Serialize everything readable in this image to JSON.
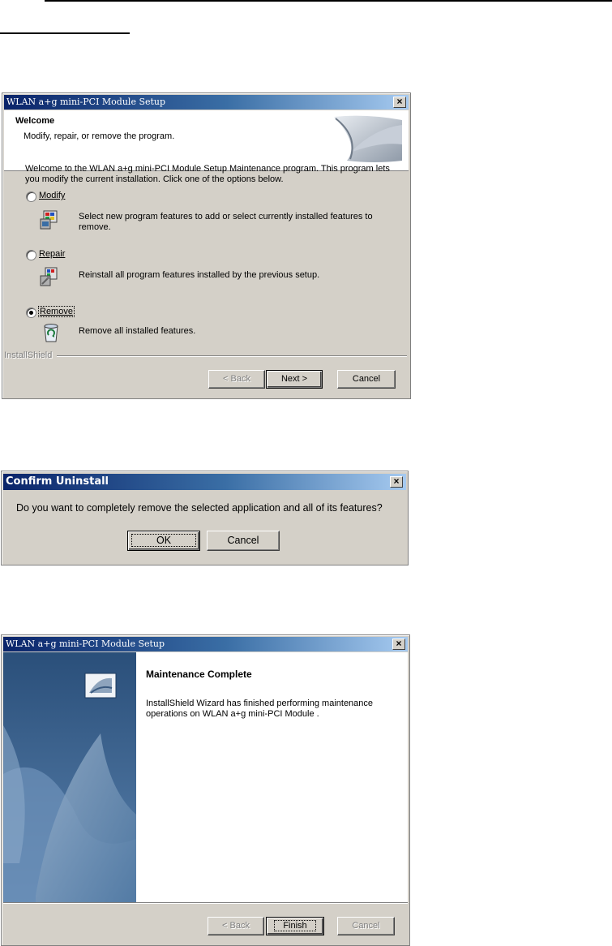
{
  "dialog1": {
    "title": "WLAN a+g mini-PCI Module Setup",
    "header_title": "Welcome",
    "header_subtitle": "Modify, repair, or remove the program.",
    "intro_line1": "Welcome to the WLAN a+g mini-PCI Module Setup Maintenance program. This program lets",
    "intro_line2": "you modify the current installation. Click one of the options below.",
    "options": [
      {
        "label": "Modify",
        "desc_line1": "Select new program features to add or select currently installed features to",
        "desc_line2": "remove.",
        "selected": false
      },
      {
        "label": "Repair",
        "desc_line1": "Reinstall all program features installed by the previous setup.",
        "selected": false
      },
      {
        "label": "Remove",
        "desc_line1": "Remove all installed features.",
        "selected": true
      }
    ],
    "brand": "InstallShield",
    "buttons": {
      "back": "< Back",
      "next": "Next >",
      "cancel": "Cancel"
    }
  },
  "dialog2": {
    "title": "Confirm Uninstall",
    "message": "Do you want to completely remove the selected application and all of its features?",
    "buttons": {
      "ok": "OK",
      "cancel": "Cancel"
    }
  },
  "dialog3": {
    "title": "WLAN a+g mini-PCI Module Setup",
    "heading": "Maintenance Complete",
    "body_line1": "InstallShield Wizard has finished performing maintenance",
    "body_line2": "operations on WLAN a+g mini-PCI Module .",
    "buttons": {
      "back": "< Back",
      "finish": "Finish",
      "cancel": "Cancel"
    }
  },
  "colors": {
    "titlebar_start": "#0a246a",
    "titlebar_end": "#a6caf0",
    "dialog_face": "#d4d0c8"
  }
}
